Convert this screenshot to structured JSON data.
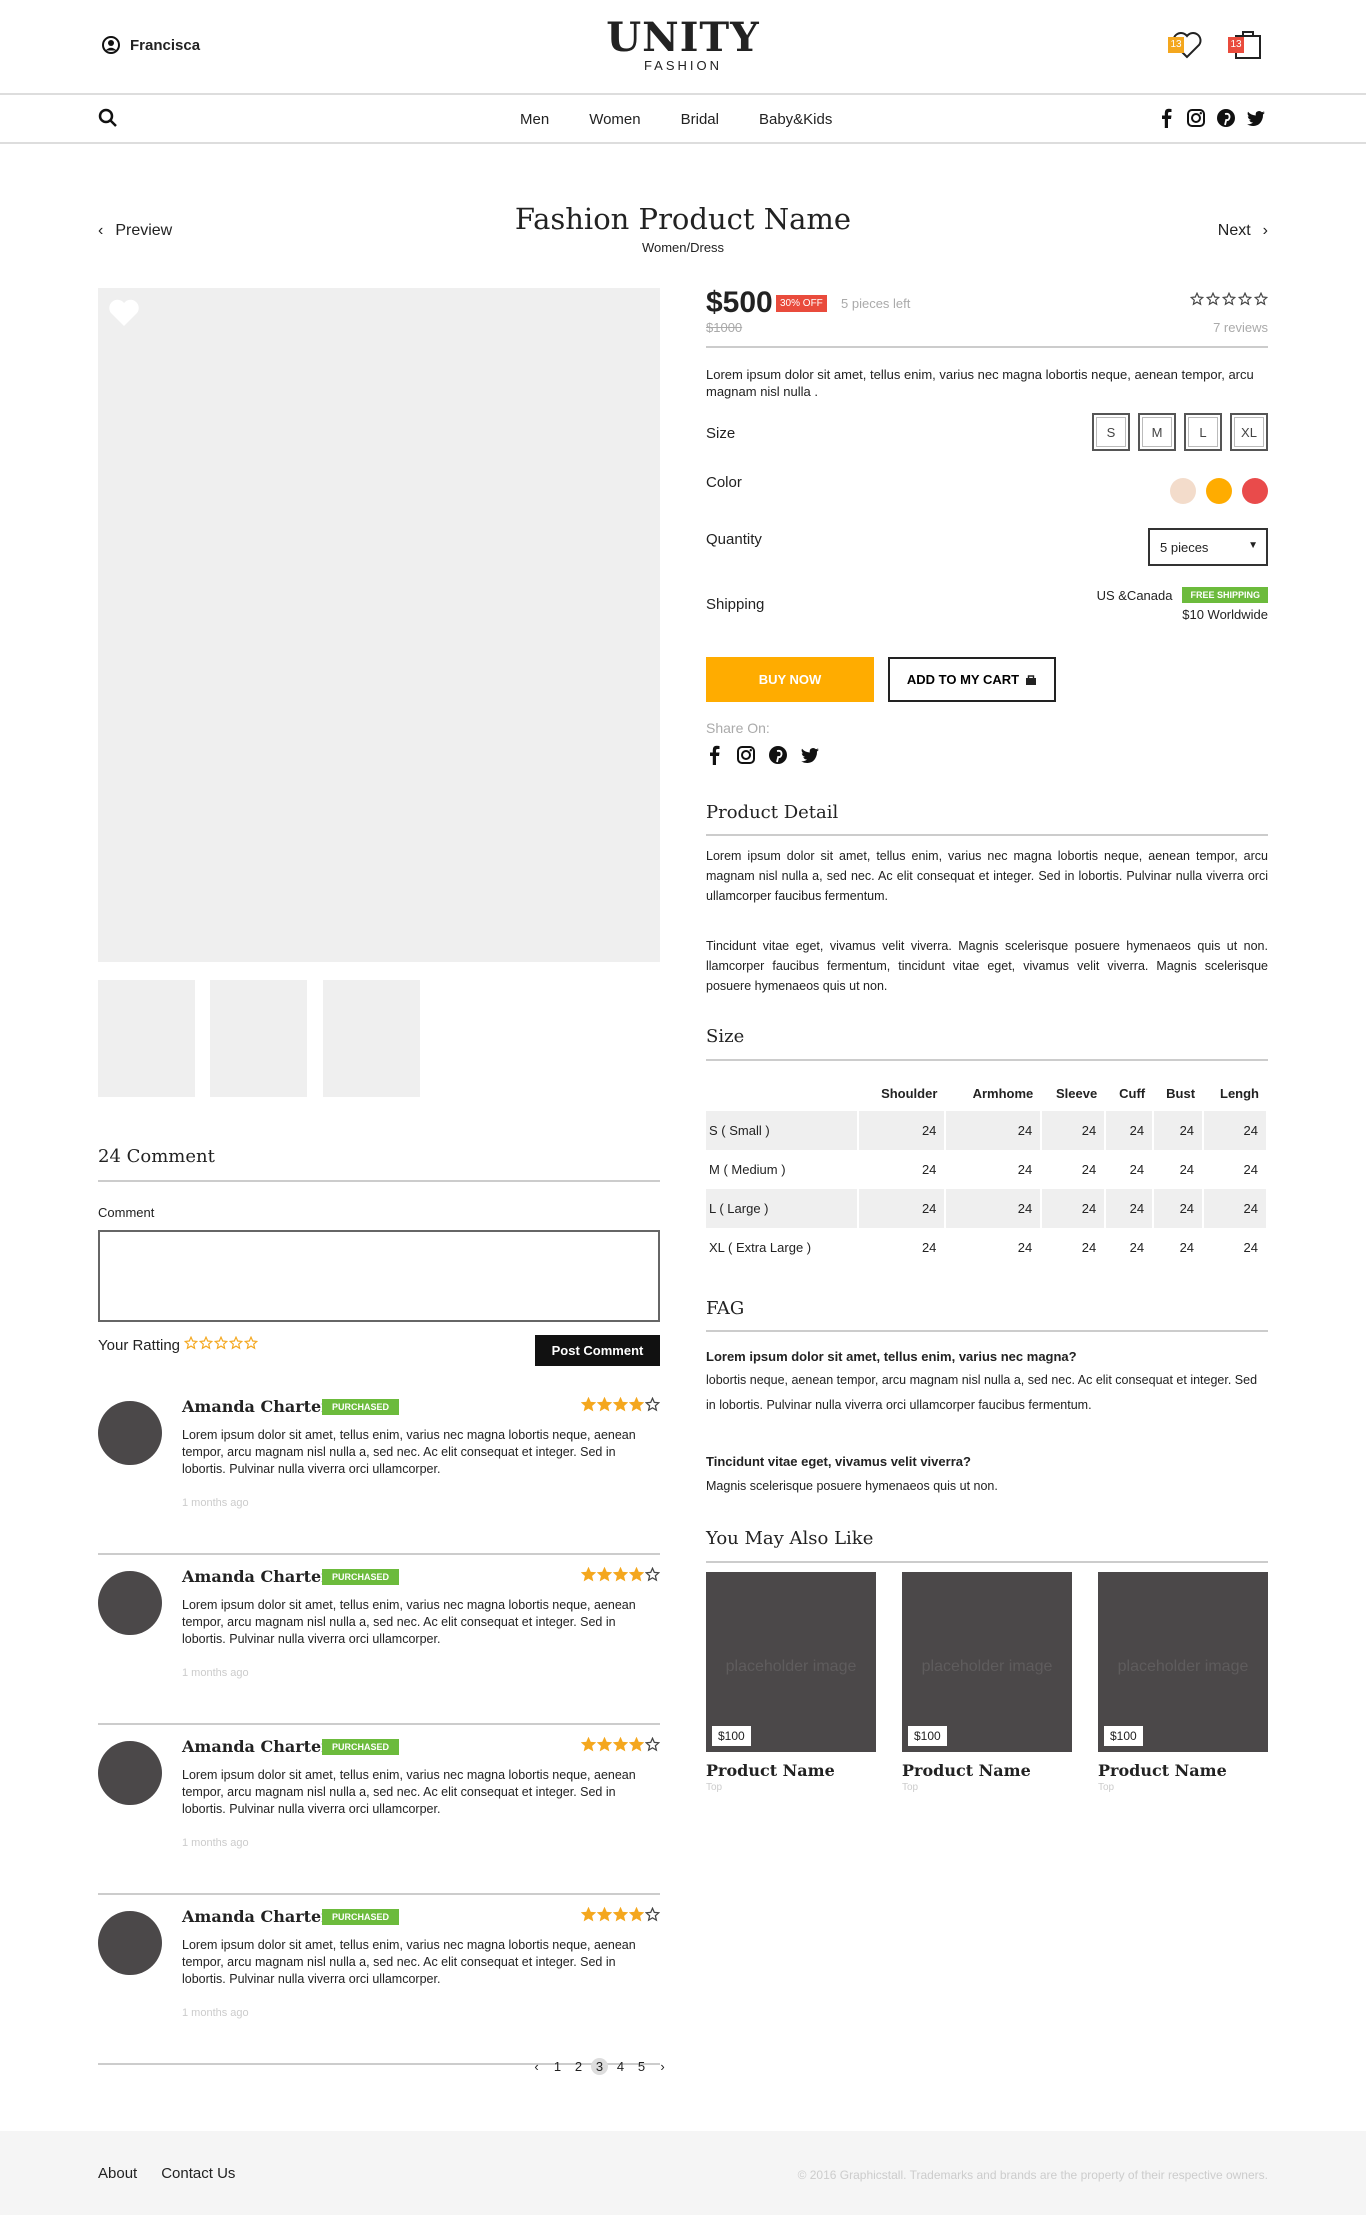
{
  "header": {
    "user_name": "Francisca",
    "brand": "UNITY",
    "brand_sub": "FASHION",
    "wishlist_count": "13",
    "cart_count": "13"
  },
  "nav": {
    "items": [
      "Men",
      "Women",
      "Bridal",
      "Baby&Kids"
    ]
  },
  "product": {
    "prev_label": "Preview",
    "next_label": "Next",
    "title": "Fashion Product Name",
    "category": "Women/Dress",
    "price": "$500",
    "off_badge": "30% OFF",
    "stock": "5 pieces left",
    "old_price": "$1000",
    "reviews": "7 reviews",
    "rating": 0,
    "description": "Lorem ipsum dolor sit amet, tellus enim, varius nec magna lobortis neque, aenean tempor, arcu magnam nisl nulla .",
    "size_label": "Size",
    "sizes": [
      "S",
      "M",
      "L",
      "XL"
    ],
    "color_label": "Color",
    "colors": [
      "#f3dccb",
      "#ffac00",
      "#e94b4b"
    ],
    "quantity_label": "Quantity",
    "quantity_value": "5 pieces",
    "shipping_label": "Shipping",
    "shipping_region": "US &Canada",
    "free_shipping_badge": "FREE SHIPPING",
    "shipping_worldwide": "$10 Worldwide",
    "buy_now": "BUY NOW",
    "add_to_cart": "ADD TO MY CART",
    "share_on": "Share On:"
  },
  "detail": {
    "heading": "Product Detail",
    "para1": "Lorem ipsum dolor sit amet, tellus enim, varius nec magna lobortis neque, aenean tempor, arcu magnam nisl nulla a, sed nec. Ac elit consequat et integer. Sed in lobortis. Pulvinar nulla viverra orci ullamcorper faucibus fermentum.",
    "para2": "Tincidunt vitae eget, vivamus velit viverra. Magnis scelerisque posuere hymenaeos quis ut non. llamcorper faucibus fermentum, tincidunt vitae eget, vivamus velit viverra. Magnis scelerisque posuere hymenaeos quis ut non."
  },
  "size_table": {
    "heading": "Size",
    "columns": [
      "",
      "Shoulder",
      "Armhome",
      "Sleeve",
      "Cuff",
      "Bust",
      "Lengh"
    ],
    "rows": [
      [
        "S ( Small )",
        "24",
        "24",
        "24",
        "24",
        "24",
        "24"
      ],
      [
        "M ( Medium )",
        "24",
        "24",
        "24",
        "24",
        "24",
        "24"
      ],
      [
        "L ( Large )",
        "24",
        "24",
        "24",
        "24",
        "24",
        "24"
      ],
      [
        "XL ( Extra Large )",
        "24",
        "24",
        "24",
        "24",
        "24",
        "24"
      ]
    ]
  },
  "faq": {
    "heading": "FAG",
    "q1": "Lorem ipsum dolor sit amet, tellus enim, varius nec magna?",
    "a1": "lobortis neque, aenean tempor, arcu magnam nisl nulla a, sed nec. Ac elit consequat et integer. Sed in lobortis. Pulvinar nulla viverra orci ullamcorper faucibus fermentum.",
    "q2": "Tincidunt vitae eget, vivamus velit viverra?",
    "a2": "Magnis scelerisque posuere hymenaeos quis ut non."
  },
  "related": {
    "heading": "You May Also Like",
    "items": [
      {
        "placeholder": "placeholder image",
        "price": "$100",
        "name": "Product Name",
        "sub": "Top"
      },
      {
        "placeholder": "placeholder image",
        "price": "$100",
        "name": "Product Name",
        "sub": "Top"
      },
      {
        "placeholder": "placeholder image",
        "price": "$100",
        "name": "Product Name",
        "sub": "Top"
      }
    ]
  },
  "comments": {
    "heading": "24 Comment",
    "label": "Comment",
    "rating_label": "Your Ratting",
    "post_button": "Post Comment",
    "items": [
      {
        "name": "Amanda Charter",
        "badge": "PURCHASED",
        "stars": 4,
        "text": "Lorem ipsum dolor sit amet, tellus enim, varius nec magna lobortis neque, aenean tempor, arcu magnam nisl nulla a, sed nec. Ac elit consequat et integer. Sed in lobortis. Pulvinar nulla viverra orci ullamcorper.",
        "ago": "1 months ago"
      },
      {
        "name": "Amanda Charter",
        "badge": "PURCHASED",
        "stars": 4,
        "text": "Lorem ipsum dolor sit amet, tellus enim, varius nec magna lobortis neque, aenean tempor, arcu magnam nisl nulla a, sed nec. Ac elit consequat et integer. Sed in lobortis. Pulvinar nulla viverra orci ullamcorper.",
        "ago": "1 months ago"
      },
      {
        "name": "Amanda Charter",
        "badge": "PURCHASED",
        "stars": 4,
        "text": "Lorem ipsum dolor sit amet, tellus enim, varius nec magna lobortis neque, aenean tempor, arcu magnam nisl nulla a, sed nec. Ac elit consequat et integer. Sed in lobortis. Pulvinar nulla viverra orci ullamcorper.",
        "ago": "1 months ago"
      },
      {
        "name": "Amanda Charter",
        "badge": "PURCHASED",
        "stars": 4,
        "text": "Lorem ipsum dolor sit amet, tellus enim, varius nec magna lobortis neque, aenean tempor, arcu magnam nisl nulla a, sed nec. Ac elit consequat et integer. Sed in lobortis. Pulvinar nulla viverra orci ullamcorper.",
        "ago": "1 months ago"
      }
    ],
    "pages": [
      "1",
      "2",
      "3",
      "4",
      "5"
    ],
    "current_page": "3"
  },
  "footer": {
    "links": [
      "About",
      "Contact Us"
    ],
    "copyright": "© 2016 Graphicstall. Trademarks and brands are the property of their respective owners."
  }
}
